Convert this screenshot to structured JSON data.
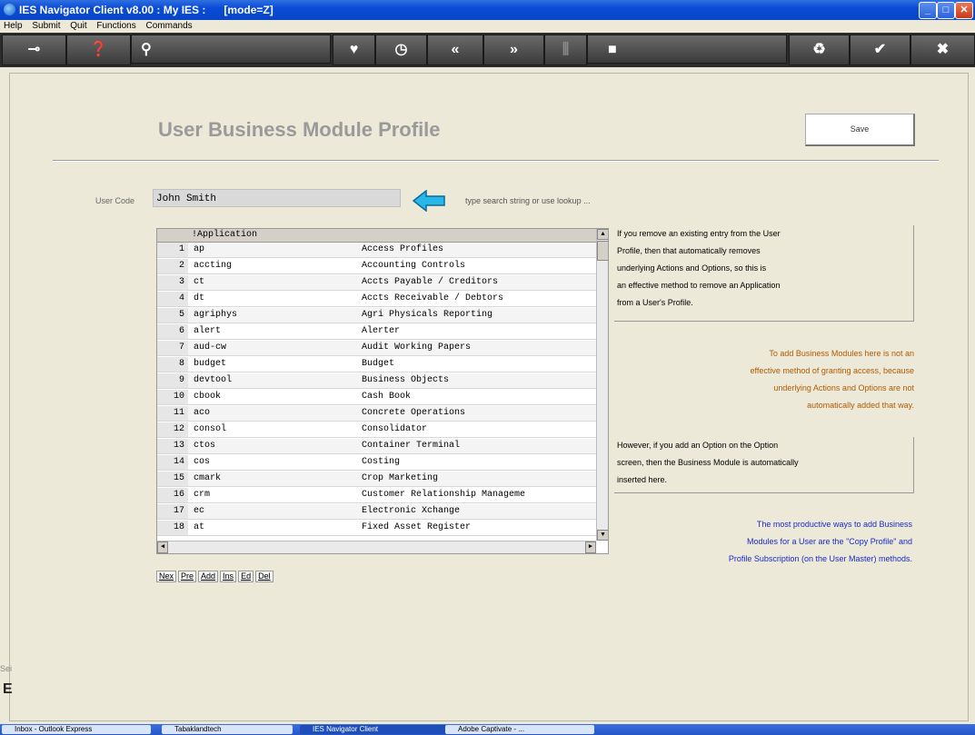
{
  "window": {
    "title": "IES Navigator Client v8.00 : My IES :      [mode=Z]",
    "min_icon": "minimize-icon",
    "max_icon": "maximize-icon",
    "close_icon": "close-icon"
  },
  "menu": [
    "Help",
    "Submit",
    "Quit",
    "Functions",
    "Commands"
  ],
  "toolbar": {
    "buttons": [
      {
        "name": "key-icon",
        "glyph": "⊸"
      },
      {
        "name": "help-icon",
        "glyph": "❓"
      },
      {
        "name": "search-icon",
        "glyph": "⚲"
      },
      {
        "name": "heart-icon",
        "glyph": "♥"
      },
      {
        "name": "clock-icon",
        "glyph": "◷"
      },
      {
        "name": "back-icon",
        "glyph": "«"
      },
      {
        "name": "forward-icon",
        "glyph": "»"
      },
      {
        "name": "split-icon",
        "glyph": "⫼"
      },
      {
        "name": "square-icon",
        "glyph": "■"
      },
      {
        "name": "refresh-icon",
        "glyph": "♻"
      },
      {
        "name": "check-icon",
        "glyph": "✔"
      },
      {
        "name": "cancel-icon",
        "glyph": "✖"
      }
    ]
  },
  "page": {
    "title": "User Business Module Profile",
    "save_label": "Save",
    "user_code_label": "User Code",
    "user_code_value": "John Smith",
    "hint": "type search string or use lookup ..."
  },
  "grid": {
    "header": "!Application",
    "rows": [
      {
        "n": "1",
        "code": "ap",
        "desc": "Access Profiles"
      },
      {
        "n": "2",
        "code": "accting",
        "desc": "Accounting Controls"
      },
      {
        "n": "3",
        "code": "ct",
        "desc": "Accts Payable / Creditors"
      },
      {
        "n": "4",
        "code": "dt",
        "desc": "Accts Receivable / Debtors"
      },
      {
        "n": "5",
        "code": "agriphys",
        "desc": "Agri Physicals Reporting"
      },
      {
        "n": "6",
        "code": "alert",
        "desc": "Alerter"
      },
      {
        "n": "7",
        "code": "aud-cw",
        "desc": "Audit Working Papers"
      },
      {
        "n": "8",
        "code": "budget",
        "desc": "Budget"
      },
      {
        "n": "9",
        "code": "devtool",
        "desc": "Business Objects"
      },
      {
        "n": "10",
        "code": "cbook",
        "desc": "Cash Book"
      },
      {
        "n": "11",
        "code": "aco",
        "desc": "Concrete Operations"
      },
      {
        "n": "12",
        "code": "consol",
        "desc": "Consolidator"
      },
      {
        "n": "13",
        "code": "ctos",
        "desc": "Container Terminal"
      },
      {
        "n": "14",
        "code": "cos",
        "desc": "Costing"
      },
      {
        "n": "15",
        "code": "cmark",
        "desc": "Crop Marketing"
      },
      {
        "n": "16",
        "code": "crm",
        "desc": "Customer Relationship Manageme"
      },
      {
        "n": "17",
        "code": "ec",
        "desc": "Electronic Xchange"
      },
      {
        "n": "18",
        "code": "at",
        "desc": "Fixed Asset Register"
      }
    ],
    "nav": [
      "Nex",
      "Pre",
      "Add",
      "Ins",
      "Ed",
      "Del"
    ]
  },
  "notes": {
    "remove": [
      "If you remove an existing entry from the User",
      "Profile, then that automatically removes",
      "underlying Actions and Options, so this is",
      "an effective method to remove an Application",
      "from a User's Profile."
    ],
    "add": [
      "To add Business Modules here is not an",
      "effective method of granting access, because",
      "underlying Actions and Options are not",
      "automatically added that way."
    ],
    "option": [
      "However, if you add an Option on the Option",
      "screen, then the Business Module is automatically",
      "inserted here."
    ],
    "productive": [
      "The most productive ways to add Business",
      "Modules for a User are the \"Copy Profile\" and",
      "Profile Subscription (on the User Master) methods."
    ]
  },
  "side": {
    "label": "Sei",
    "glyph": "E"
  },
  "taskbar": [
    "Inbox - Outlook Express",
    "Tabaklandtech",
    "IES Navigator Client",
    "Adobe Captivate - ..."
  ],
  "colors": {
    "title_gray": "#9a9a9a",
    "orange": "#b05a00",
    "blue": "#1a2ac8",
    "arrow": "#29b6e8"
  }
}
